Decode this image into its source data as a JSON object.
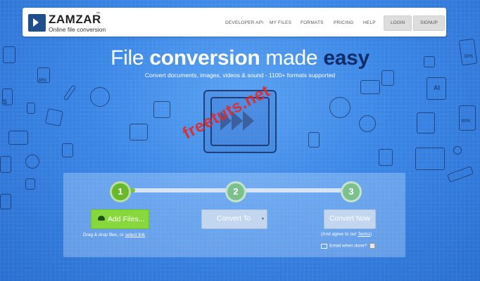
{
  "brand": {
    "name": "ZAMZAR",
    "tm": "™",
    "tagline": "Online file conversion"
  },
  "nav": {
    "developer_api": "DEVELOPER API",
    "my_files": "MY FILES",
    "formats": "FORMATS",
    "pricing": "PRICING",
    "help": "HELP",
    "login": "LOGIN",
    "signup": "SIGNUP"
  },
  "hero": {
    "title_plain": "File ",
    "title_bold": "conversion",
    "title_mid": " made ",
    "title_easy": "easy",
    "subtitle": "Convert documents, images, videos & sound - 1100+ formats supported"
  },
  "doodles": [
    "JPG",
    "EPS",
    "AI",
    "EPS",
    "S"
  ],
  "watermark": "freetuts.net",
  "converter": {
    "steps": [
      "1",
      "2",
      "3"
    ],
    "add_files_label": "Add Files...",
    "drag_text": "Drag & drop files, or ",
    "select_link": "select link",
    "convert_to_label": "Convert To",
    "convert_to_caret": "▾",
    "convert_now_label": "Convert Now",
    "agree_prefix": "(And agree to our ",
    "agree_link": "Terms",
    "agree_suffix": ")",
    "email_label": "Email when done?"
  },
  "colors": {
    "background": "#2f7fe0",
    "step_active": "#68b82c",
    "add_button": "#87d83d",
    "easy_text": "#0f2c6b",
    "watermark": "#e62828"
  }
}
